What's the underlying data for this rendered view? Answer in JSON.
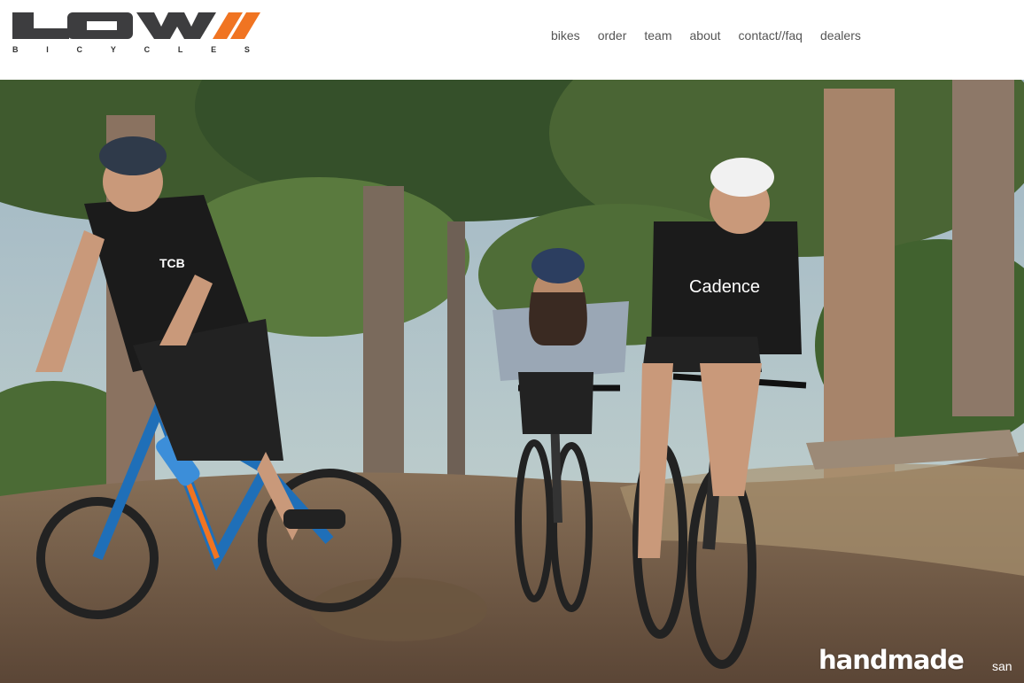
{
  "brand": {
    "logo_text": "LOW//",
    "tagline_letters": [
      "B",
      "I",
      "C",
      "Y",
      "C",
      "L",
      "E",
      "S"
    ],
    "accent_color": "#f07422",
    "logo_color": "#3d3d3f"
  },
  "nav": {
    "items": [
      {
        "label": "bikes"
      },
      {
        "label": "order"
      },
      {
        "label": "team"
      },
      {
        "label": "about"
      },
      {
        "label": "contact//faq"
      },
      {
        "label": "dealers"
      }
    ]
  },
  "hero": {
    "scene": "three riders on gravel bikes on a forest dirt trail",
    "rider_left_shirt_text": "TCB",
    "rider_right_shirt_text": "Cadence",
    "caption": "handmade",
    "caption_suffix": "san"
  }
}
